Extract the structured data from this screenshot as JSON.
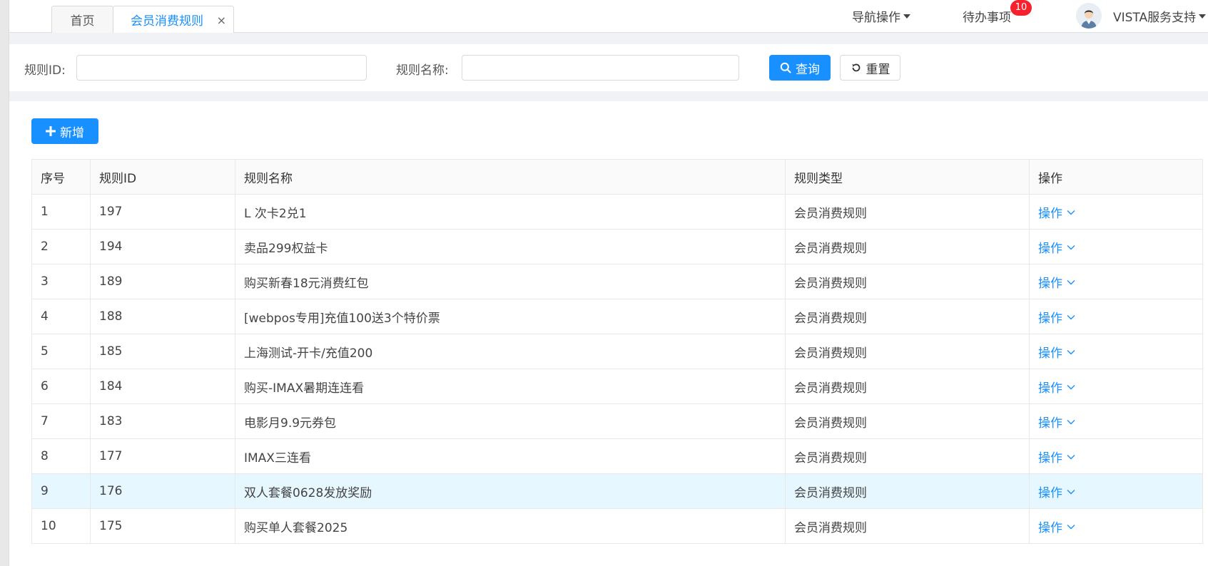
{
  "tabs": {
    "home": "首页",
    "active": "会员消费规则",
    "close": "×"
  },
  "header": {
    "nav_operations": "导航操作",
    "todo": "待办事项",
    "todo_count": "10",
    "user_name": "VISTA服务支持"
  },
  "search": {
    "rule_id_label": "规则ID:",
    "rule_id_value": "",
    "rule_name_label": "规则名称:",
    "rule_name_value": "",
    "query_button": "查询",
    "reset_button": "重置"
  },
  "toolbar": {
    "add_button": "新增"
  },
  "table": {
    "columns": [
      "序号",
      "规则ID",
      "规则名称",
      "规则类型",
      "操作"
    ],
    "highlight_row": 8,
    "rows": [
      {
        "no": "1",
        "id": "197",
        "name": "L 次卡2兑1",
        "type": "会员消费规则",
        "action": "操作"
      },
      {
        "no": "2",
        "id": "194",
        "name": "卖品299权益卡",
        "type": "会员消费规则",
        "action": "操作"
      },
      {
        "no": "3",
        "id": "189",
        "name": "购买新春18元消费红包",
        "type": "会员消费规则",
        "action": "操作"
      },
      {
        "no": "4",
        "id": "188",
        "name": "[webpos专用]充值100送3个特价票",
        "type": "会员消费规则",
        "action": "操作"
      },
      {
        "no": "5",
        "id": "185",
        "name": "上海测试-开卡/充值200",
        "type": "会员消费规则",
        "action": "操作"
      },
      {
        "no": "6",
        "id": "184",
        "name": "购买-IMAX暑期连连看",
        "type": "会员消费规则",
        "action": "操作"
      },
      {
        "no": "7",
        "id": "183",
        "name": "电影月9.9元券包",
        "type": "会员消费规则",
        "action": "操作"
      },
      {
        "no": "8",
        "id": "177",
        "name": "IMAX三连看",
        "type": "会员消费规则",
        "action": "操作"
      },
      {
        "no": "9",
        "id": "176",
        "name": "双人套餐0628发放奖励",
        "type": "会员消费规则",
        "action": "操作"
      },
      {
        "no": "10",
        "id": "175",
        "name": "购买单人套餐2025",
        "type": "会员消费规则",
        "action": "操作"
      }
    ]
  },
  "colors": {
    "primary": "#1890ff",
    "highlight_row_bg": "#e6f7ff",
    "badge": "#f5222d"
  }
}
